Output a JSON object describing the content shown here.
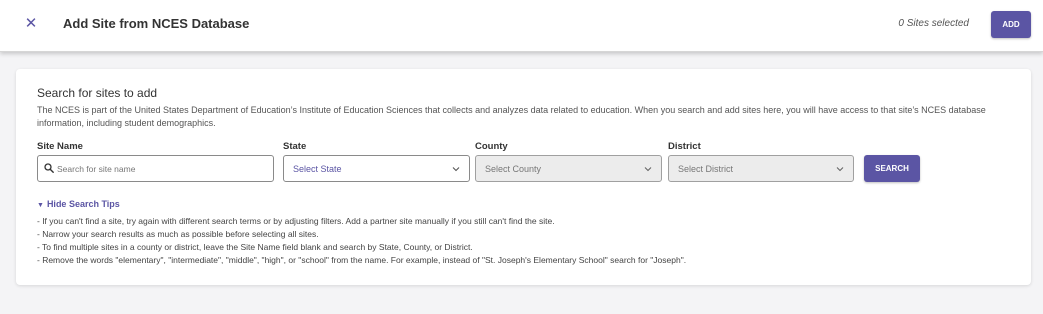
{
  "header": {
    "title": "Add Site from NCES Database",
    "close_icon": "close-icon",
    "close_glyph": "✕",
    "sites_selected": "0 Sites selected",
    "add_label": "ADD"
  },
  "panel": {
    "title": "Search for sites to add",
    "description": "The NCES is part of the United States Department of Education’s Institute of Education Sciences that collects and analyzes data related to education. When you search and add sites here, you will have access to that site’s NCES database information, including student demographics."
  },
  "filters": {
    "site_name": {
      "label": "Site Name",
      "placeholder": "Search for site name",
      "icon": "search-icon"
    },
    "state": {
      "label": "State",
      "value": "Select State"
    },
    "county": {
      "label": "County",
      "value": "Select County",
      "disabled": true
    },
    "district": {
      "label": "District",
      "value": "Select District",
      "disabled": true
    },
    "search_label": "SEARCH"
  },
  "tips": {
    "toggle_label": "Hide Search Tips",
    "items": [
      "- If you can't find a site, try again with different search terms or by adjusting filters. Add a partner site manually if you still can't find the site.",
      "- Narrow your search results as much as possible before selecting all sites.",
      "- To find multiple sites in a county or district, leave the Site Name field blank and search by State, County, or District.",
      "- Remove the words \"elementary\", \"intermediate\", \"middle\", \"high\", or \"school\" from the name. For example, instead of \"St. Joseph's Elementary School\" search for \"Joseph\"."
    ]
  },
  "colors": {
    "accent": "#5b55a4",
    "background": "#f4f4f6",
    "disabled_field": "#ececec"
  }
}
